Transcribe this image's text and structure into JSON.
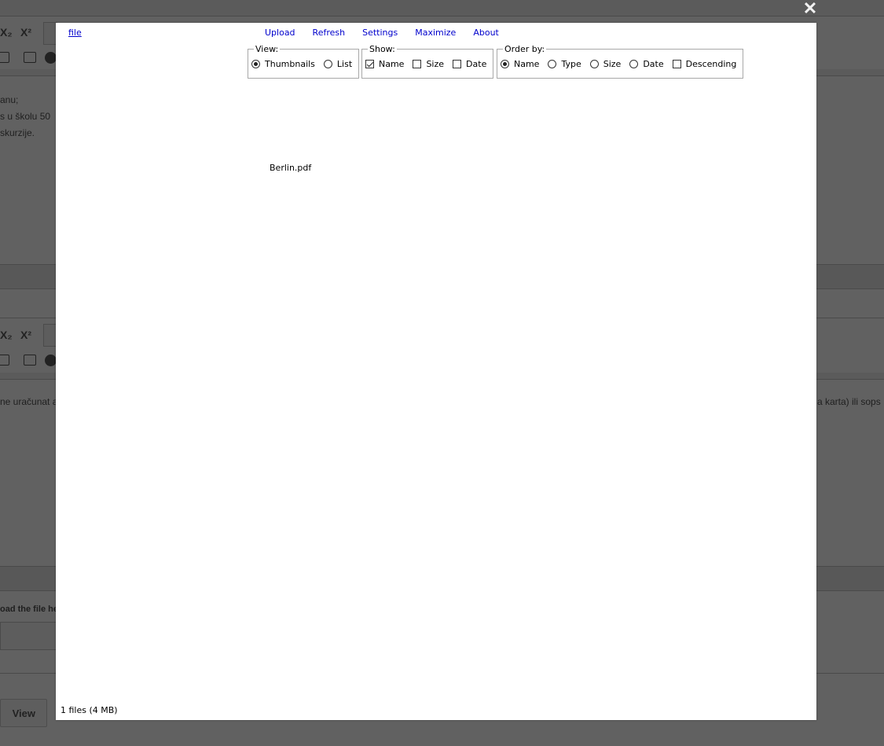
{
  "background": {
    "toolbar1": {
      "subscript": "X₂",
      "superscript": "X²"
    },
    "toolbar2": {
      "subscript": "X₂",
      "superscript": "X²"
    },
    "text_lines_top": [
      "anu;",
      "s u školu 50",
      "skurzije."
    ],
    "text_line_mid_left": "ne uračunat a",
    "text_line_mid_right": "a karta) ili sops",
    "upload_hint": "oad the file he",
    "view_button": "View"
  },
  "close_icon": "✕",
  "dialog": {
    "path_link": " file",
    "menu": [
      "Upload",
      "Refresh",
      "Settings",
      "Maximize",
      "About"
    ],
    "view_group": {
      "legend": "View:",
      "options": [
        {
          "label": "Thumbnails",
          "selected": true
        },
        {
          "label": "List",
          "selected": false
        }
      ]
    },
    "show_group": {
      "legend": "Show:",
      "options": [
        {
          "label": "Name",
          "checked": true
        },
        {
          "label": "Size",
          "checked": false
        },
        {
          "label": "Date",
          "checked": false
        }
      ]
    },
    "order_group": {
      "legend": "Order by:",
      "options": [
        {
          "label": "Name",
          "selected": true
        },
        {
          "label": "Type",
          "selected": false
        },
        {
          "label": "Size",
          "selected": false
        },
        {
          "label": "Date",
          "selected": false
        }
      ],
      "descending": {
        "label": "Descending",
        "checked": false
      }
    },
    "files": [
      {
        "name": "Berlin.pdf"
      }
    ],
    "status": "1 files (4 MB)"
  }
}
